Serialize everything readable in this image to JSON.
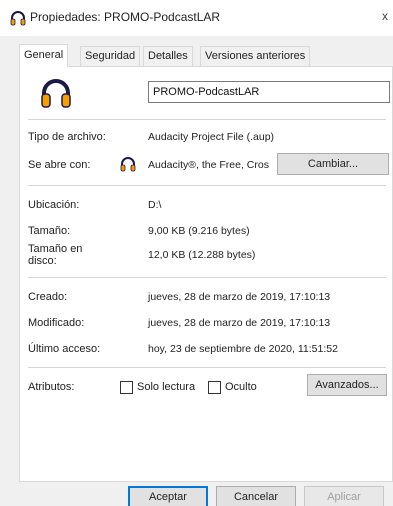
{
  "window": {
    "title": "Propiedades: PROMO-PodcastLAR",
    "close_glyph": "x"
  },
  "tabs": [
    {
      "label": "General",
      "active": true
    },
    {
      "label": "Seguridad",
      "active": false
    },
    {
      "label": "Detalles",
      "active": false
    },
    {
      "label": "Versiones anteriores",
      "active": false
    }
  ],
  "general": {
    "file_name": "PROMO-PodcastLAR",
    "file_icon": "headphones-icon",
    "type_label": "Tipo de archivo:",
    "type_value": "Audacity Project File (.aup)",
    "opens_with_label": "Se abre con:",
    "opens_with_value": "Audacity®, the Free, Cros",
    "opens_with_icon": "headphones-icon",
    "change_button": "Cambiar...",
    "location_label": "Ubicación:",
    "location_value": "D:\\",
    "size_label": "Tamaño:",
    "size_value": "9,00 KB (9.216 bytes)",
    "disk_size_label_line1": "Tamaño en",
    "disk_size_label_line2": "disco:",
    "disk_size_value": "12,0 KB (12.288 bytes)",
    "created_label": "Creado:",
    "created_value": "jueves, 28 de marzo de 2019, 17:10:13",
    "modified_label": "Modificado:",
    "modified_value": "jueves, 28 de marzo de 2019, 17:10:13",
    "accessed_label": "Último acceso:",
    "accessed_value": "hoy, 23 de septiembre de 2020, 11:51:52",
    "attributes_label": "Atributos:",
    "readonly_label": "Solo lectura",
    "readonly_checked": false,
    "hidden_label": "Oculto",
    "hidden_checked": false,
    "advanced_button": "Avanzados..."
  },
  "footer": {
    "ok_button": "Aceptar",
    "cancel_button": "Cancelar",
    "apply_button": "Aplicar"
  },
  "colors": {
    "headphones_orange": "#f5a000",
    "headphones_dark": "#1a1a4a",
    "accent_blue": "#0078d7"
  }
}
